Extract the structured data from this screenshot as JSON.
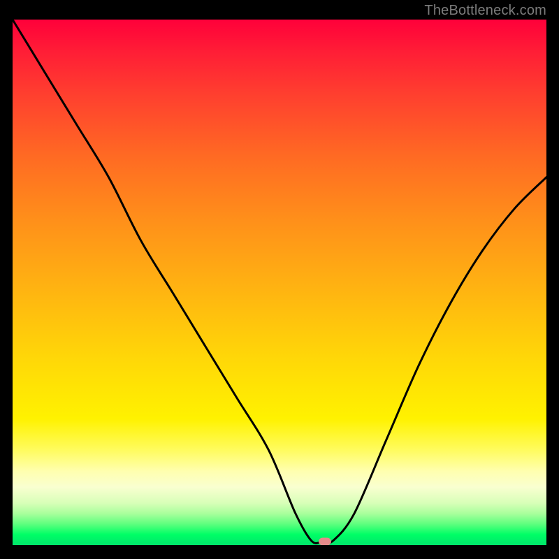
{
  "watermark": "TheBottleneck.com",
  "chart_data": {
    "type": "line",
    "title": "",
    "xlabel": "",
    "ylabel": "",
    "xlim": [
      0,
      100
    ],
    "ylim": [
      0,
      100
    ],
    "grid": false,
    "legend": false,
    "series": [
      {
        "name": "bottleneck-curve",
        "x": [
          0,
          6,
          12,
          18,
          24,
          30,
          36,
          42,
          48,
          53,
          56,
          58,
          60,
          64,
          70,
          76,
          82,
          88,
          94,
          100
        ],
        "y": [
          100,
          90,
          80,
          70,
          58,
          48,
          38,
          28,
          18,
          6,
          0.8,
          0.6,
          0.8,
          6,
          20,
          34,
          46,
          56,
          64,
          70
        ]
      }
    ],
    "marker": {
      "x": 58.5,
      "y": 0.6,
      "color": "#e58a8a"
    },
    "background_gradient": {
      "top": "#ff003a",
      "mid": "#ffd400",
      "bottom": "#00e56a"
    }
  }
}
